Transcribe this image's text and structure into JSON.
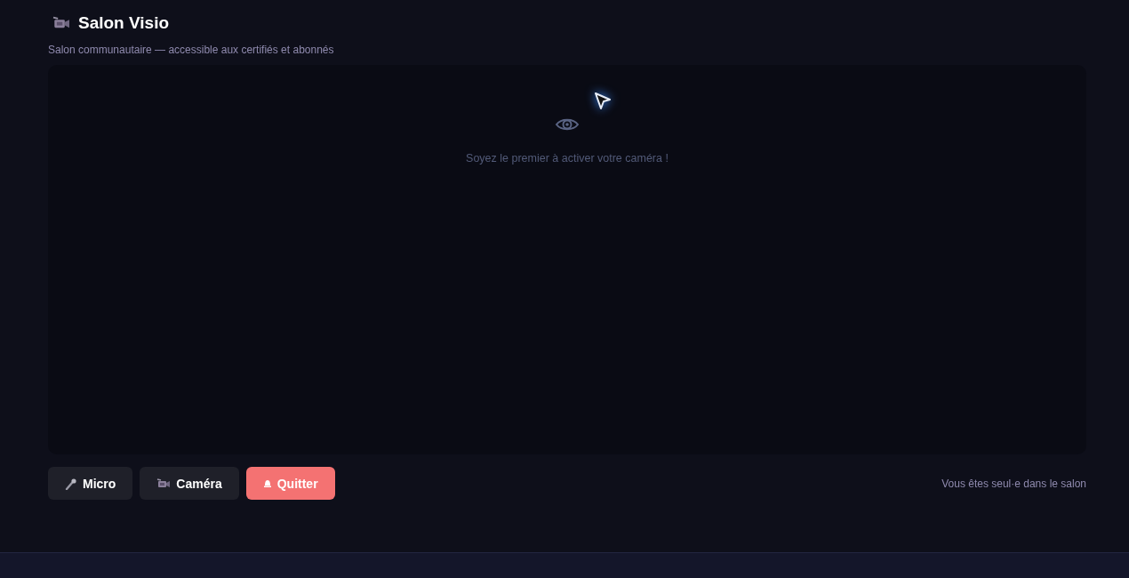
{
  "header": {
    "title": "Salon Visio",
    "subtitle": "Salon communautaire — accessible aux certifiés et abonnés"
  },
  "stage": {
    "empty_message": "Soyez le premier à activer votre caméra !"
  },
  "controls": [
    {
      "kind": "micro",
      "label": "Micro"
    },
    {
      "kind": "camera",
      "label": "Caméra"
    },
    {
      "kind": "leave",
      "label": "Quitter"
    }
  ],
  "status": "Vous êtes seul·e dans le salon"
}
